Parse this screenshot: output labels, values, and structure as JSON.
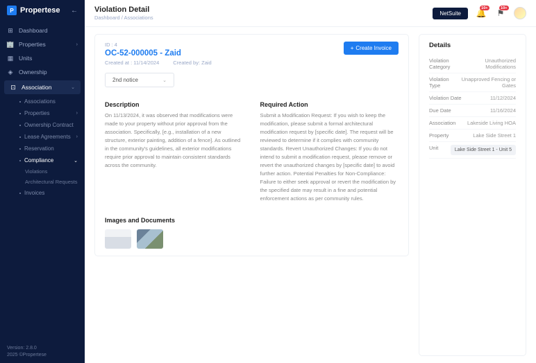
{
  "brand": "Propertese",
  "topbar": {
    "title": "Violation Detail",
    "breadcrumb": "Dashboard / Associations",
    "netsuite_label": "NetSuite",
    "badge1": "10+",
    "badge2": "10+"
  },
  "nav": {
    "dashboard": "Dashboard",
    "properties": "Properties",
    "units": "Units",
    "ownership": "Ownership",
    "association": "Association",
    "associations": "Associations",
    "props": "Properties",
    "ownership_contract": "Ownership Contract",
    "lease_agreements": "Lease Agreements",
    "reservation": "Reservation",
    "compliance": "Compliance",
    "violations": "Violations",
    "arch_requests": "Architectural Requests",
    "invoices": "Invoices"
  },
  "footer": {
    "version": "Version: 2.8.0",
    "copyright": "2025 ©Propertese"
  },
  "violation": {
    "id_label": "ID : 4",
    "title": "OC-52-000005 - Zaid",
    "created_at": "Created at : 11/14/2024",
    "created_by": "Created by: Zaid",
    "create_invoice": "Create Invoice",
    "notice_select": "2nd notice",
    "desc_title": "Description",
    "desc_text": "On 11/13/2024, it was observed that modifications were made to your property without prior approval from the association. Specifically, [e.g., installation of a new structure, exterior painting, addition of a fence]. As outlined in the community's guidelines, all exterior modifications require prior approval to maintain consistent standards across the community.",
    "action_title": "Required Action",
    "action_text": "Submit a Modification Request: If you wish to keep the modification, please submit a formal architectural modification request by [specific date]. The request will be reviewed to determine if it complies with community standards. Revert Unauthorized Changes: If you do not intend to submit a modification request, please remove or revert the unauthorized changes by [specific date] to avoid further action. Potential Penalties for Non-Compliance: Failure to either seek approval or revert the modification by the specified date may result in a fine and potential enforcement actions as per community rules.",
    "images_title": "Images and Documents"
  },
  "details": {
    "title": "Details",
    "rows": [
      {
        "label": "Violation Category",
        "value": "Unauthorized Modifications"
      },
      {
        "label": "Violation Type",
        "value": "Unapproved Fencing or Gates"
      },
      {
        "label": "Violation Date",
        "value": "11/12/2024"
      },
      {
        "label": "Due Date",
        "value": "11/16/2024"
      },
      {
        "label": "Association",
        "value": "Lakeside Living HOA"
      },
      {
        "label": "Property",
        "value": "Lake Side Street 1"
      }
    ],
    "unit_label": "Unit",
    "unit_value": "Lake Side Street 1 - Unit 5"
  }
}
